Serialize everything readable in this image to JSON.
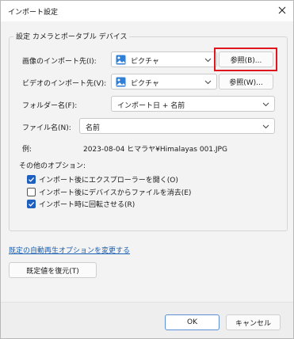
{
  "window": {
    "title": "インポート設定"
  },
  "group": {
    "label": "設定  カメラとポータブル デバイス"
  },
  "images": {
    "label": "画像のインポート先(I):",
    "value": "ピクチャ",
    "browse": "参照(B)..."
  },
  "videos": {
    "label": "ビデオのインポート先(V):",
    "value": "ピクチャ",
    "browse": "参照(W)..."
  },
  "folder": {
    "label": "フォルダー名(F):",
    "value": "インポート日 + 名前"
  },
  "file": {
    "label": "ファイル名(N):",
    "value": "名前"
  },
  "example": {
    "label": "例:",
    "value": "2023-08-04 ヒマラヤ¥Himalayas 001.JPG"
  },
  "other": {
    "label": "その他のオプション:",
    "options": [
      {
        "label": "インポート後にエクスプローラーを開く(O)",
        "checked": true
      },
      {
        "label": "インポート後にデバイスからファイルを消去(E)",
        "checked": false
      },
      {
        "label": "インポート時に回転させる(R)",
        "checked": true
      }
    ]
  },
  "autoplay_link": "既定の自動再生オプションを変更する",
  "restore_button": "既定値を復元(T)",
  "footer": {
    "ok": "OK",
    "cancel": "キャンセル"
  },
  "colors": {
    "accent": "#1f5fbf",
    "highlight": "#e0161e",
    "link": "#1a5fb4"
  }
}
